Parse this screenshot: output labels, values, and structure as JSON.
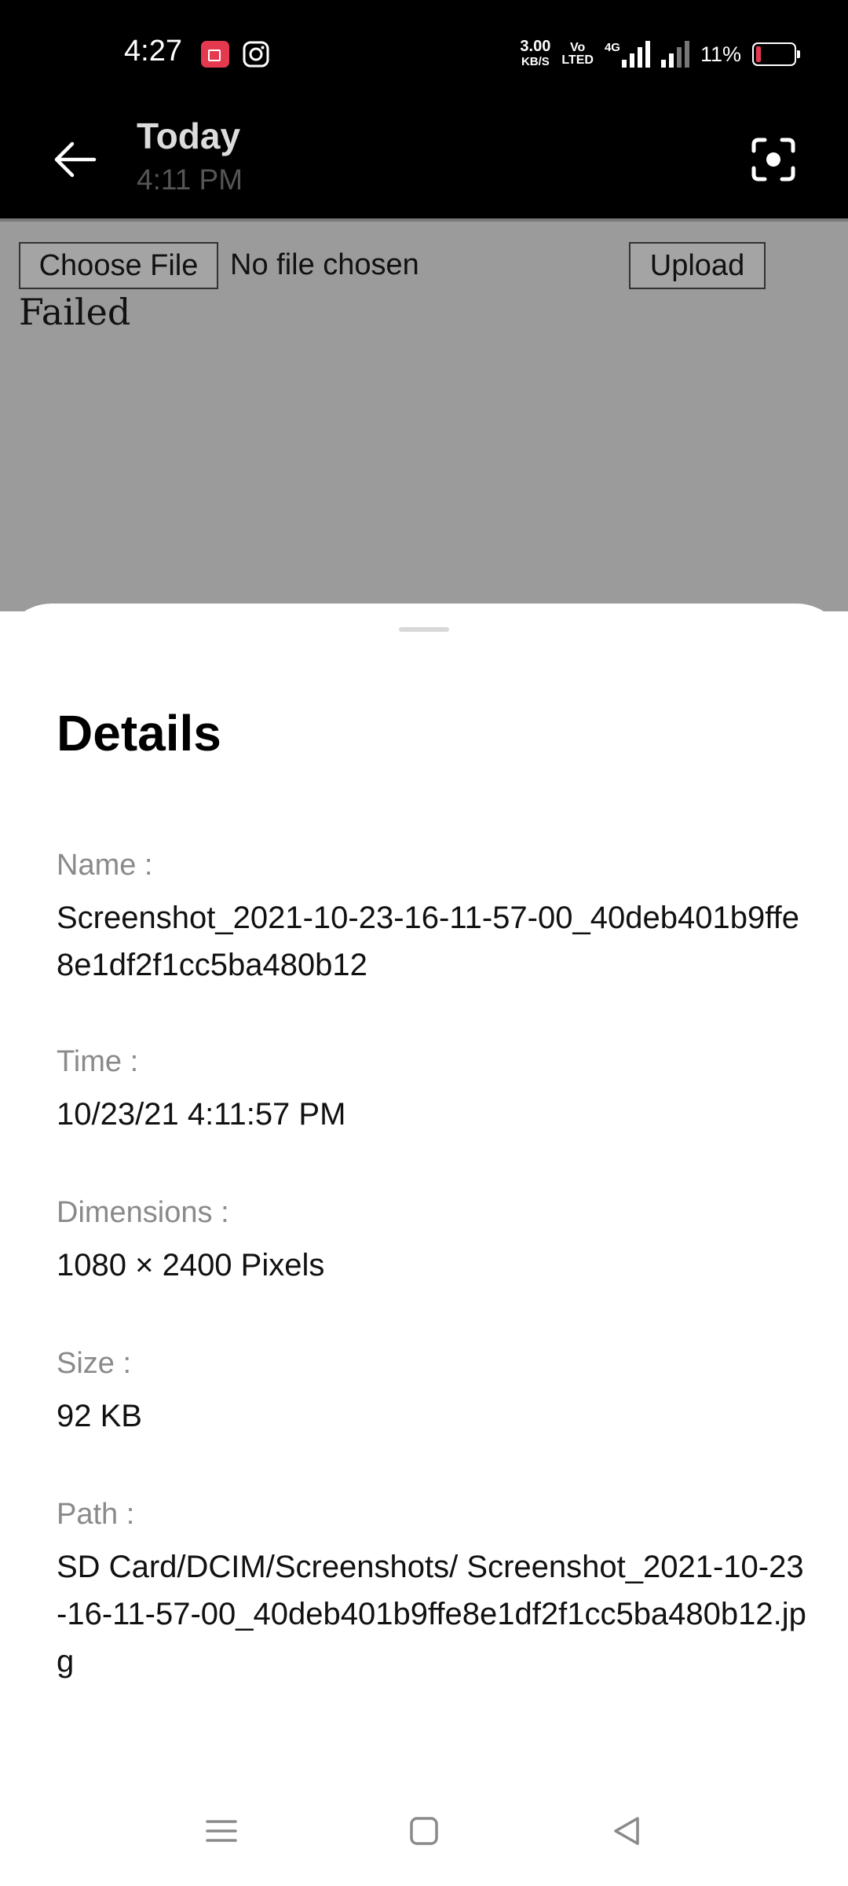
{
  "status_bar": {
    "time": "4:27",
    "speed_value": "3.00",
    "speed_unit": "KB/S",
    "volte_top": "Vo",
    "volte_bottom": "LTED",
    "network": "4G",
    "battery": "11%",
    "icons": [
      "screen-recorder-icon",
      "instagram-icon",
      "signal-icon",
      "battery-icon"
    ],
    "battery_color": "#e53950"
  },
  "app_bar": {
    "title": "Today",
    "subtitle": "4:11 PM",
    "icons": [
      "back-arrow-icon",
      "lens-scan-icon"
    ]
  },
  "web_page": {
    "choose_file_label": "Choose File",
    "no_file_text": "No file chosen",
    "upload_label": "Upload",
    "result_text": "Failed"
  },
  "details": {
    "title": "Details",
    "name_label": "Name :",
    "name_value": "Screenshot_2021-10-23-16-11-57-00_40deb401b9ffe8e1df2f1cc5ba480b12",
    "time_label": "Time :",
    "time_value": "10/23/21 4:11:57 PM",
    "dimensions_label": "Dimensions :",
    "dimensions_value": "1080 × 2400 Pixels",
    "size_label": "Size :",
    "size_value": "92 KB",
    "path_label": "Path :",
    "path_value": "SD Card/DCIM/Screenshots/ Screenshot_2021-10-23-16-11-57-00_40deb401b9ffe8e1df2f1cc5ba480b12.jpg"
  },
  "nav_bar": {
    "icons": [
      "menu-icon",
      "home-icon",
      "back-triangle-icon"
    ]
  }
}
